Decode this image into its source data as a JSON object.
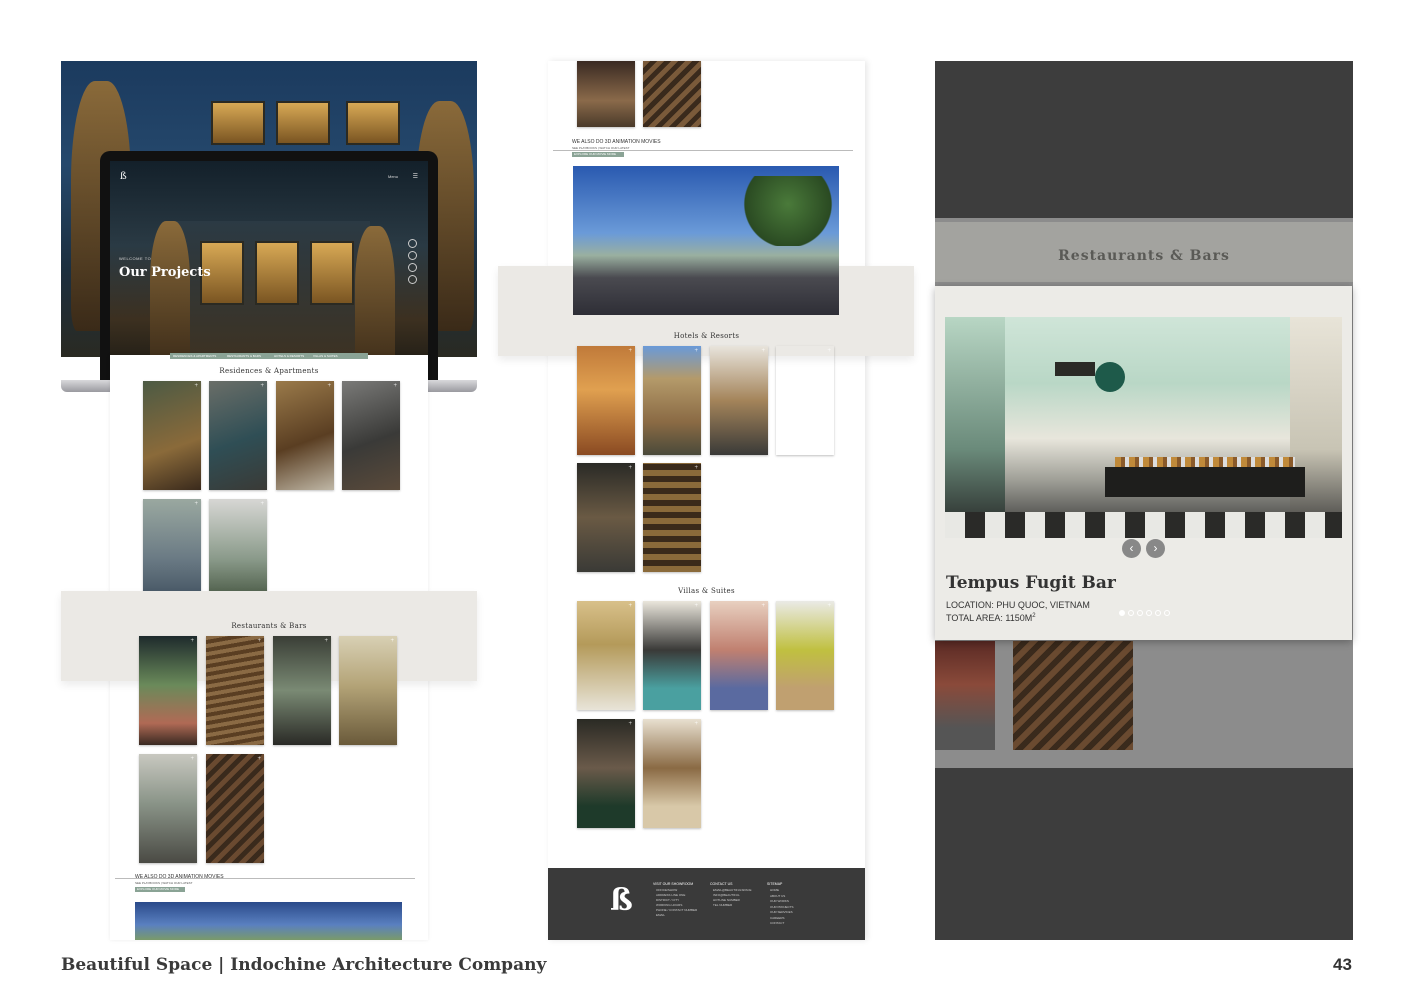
{
  "panel1": {
    "hero": {
      "eyebrow": "WELCOME TO",
      "title": "Our Projects",
      "menu_label": "Menu"
    },
    "nav_tabs": [
      "RESIDENCES & APARTMENTS",
      "RESTAURANTS & BARS",
      "HOTELS & RESORTS",
      "VILLAS & SUITES"
    ],
    "sections": {
      "residences": "Residences & Apartments",
      "restaurants": "Restaurants & Bars"
    },
    "animation": {
      "heading": "WE ALSO DO 3D ANIMATION MOVIES",
      "sub": "SEE PLAYBOOKS | WATCH OUR LATEST",
      "button": "EXPLORE OUR MOVIE MORE"
    }
  },
  "panel2": {
    "animation": {
      "heading": "WE ALSO DO 3D ANIMATION MOVIES",
      "sub": "SEE PLAYBOOKS | WATCH OUR LATEST",
      "button": "EXPLORE OUR MOVIE MORE"
    },
    "sections": {
      "hotels": "Hotels & Resorts",
      "villas": "Villas & Suites"
    },
    "footer": {
      "col1_title": "VISIT OUR SHOWROOM",
      "col1_lines": [
        "OFFICE/SHOW",
        "ADDRESS LINE ONE",
        "DISTRICT / CITY",
        "WORKING HOURS",
        "PHONE / CONTACT NUMBER",
        "EMAIL"
      ],
      "col2_title": "CONTACT US",
      "col2_lines": [
        "EMAIL@BEAUTIFULSPACE",
        "INFO@BEAUTIFUL",
        "HOTLINE NUMBER",
        "TEL NUMBER"
      ],
      "col3_title": "SITEMAP",
      "col3_lines": [
        "HOME",
        "ABOUT US",
        "OUR WORKS",
        "OUR PROJECTS",
        "OUR SERVICES",
        "CAREERS",
        "CONTACT"
      ]
    }
  },
  "panel3": {
    "band_title": "Restaurants & Bars",
    "project_name": "Tempus Fugit Bar",
    "location": "LOCATION: PHU QUOC, VIETNAM",
    "area": "TOTAL AREA: 1150M",
    "area_sup": "2",
    "prev": "‹",
    "next": "›"
  },
  "footer": {
    "left": "Beautiful Space | Indochine Architecture Company",
    "page_number": "43"
  },
  "colors": {
    "accent_green": "#8aa395",
    "band_beige": "#ebe9e5",
    "dark_grey": "#3d3d3d"
  }
}
